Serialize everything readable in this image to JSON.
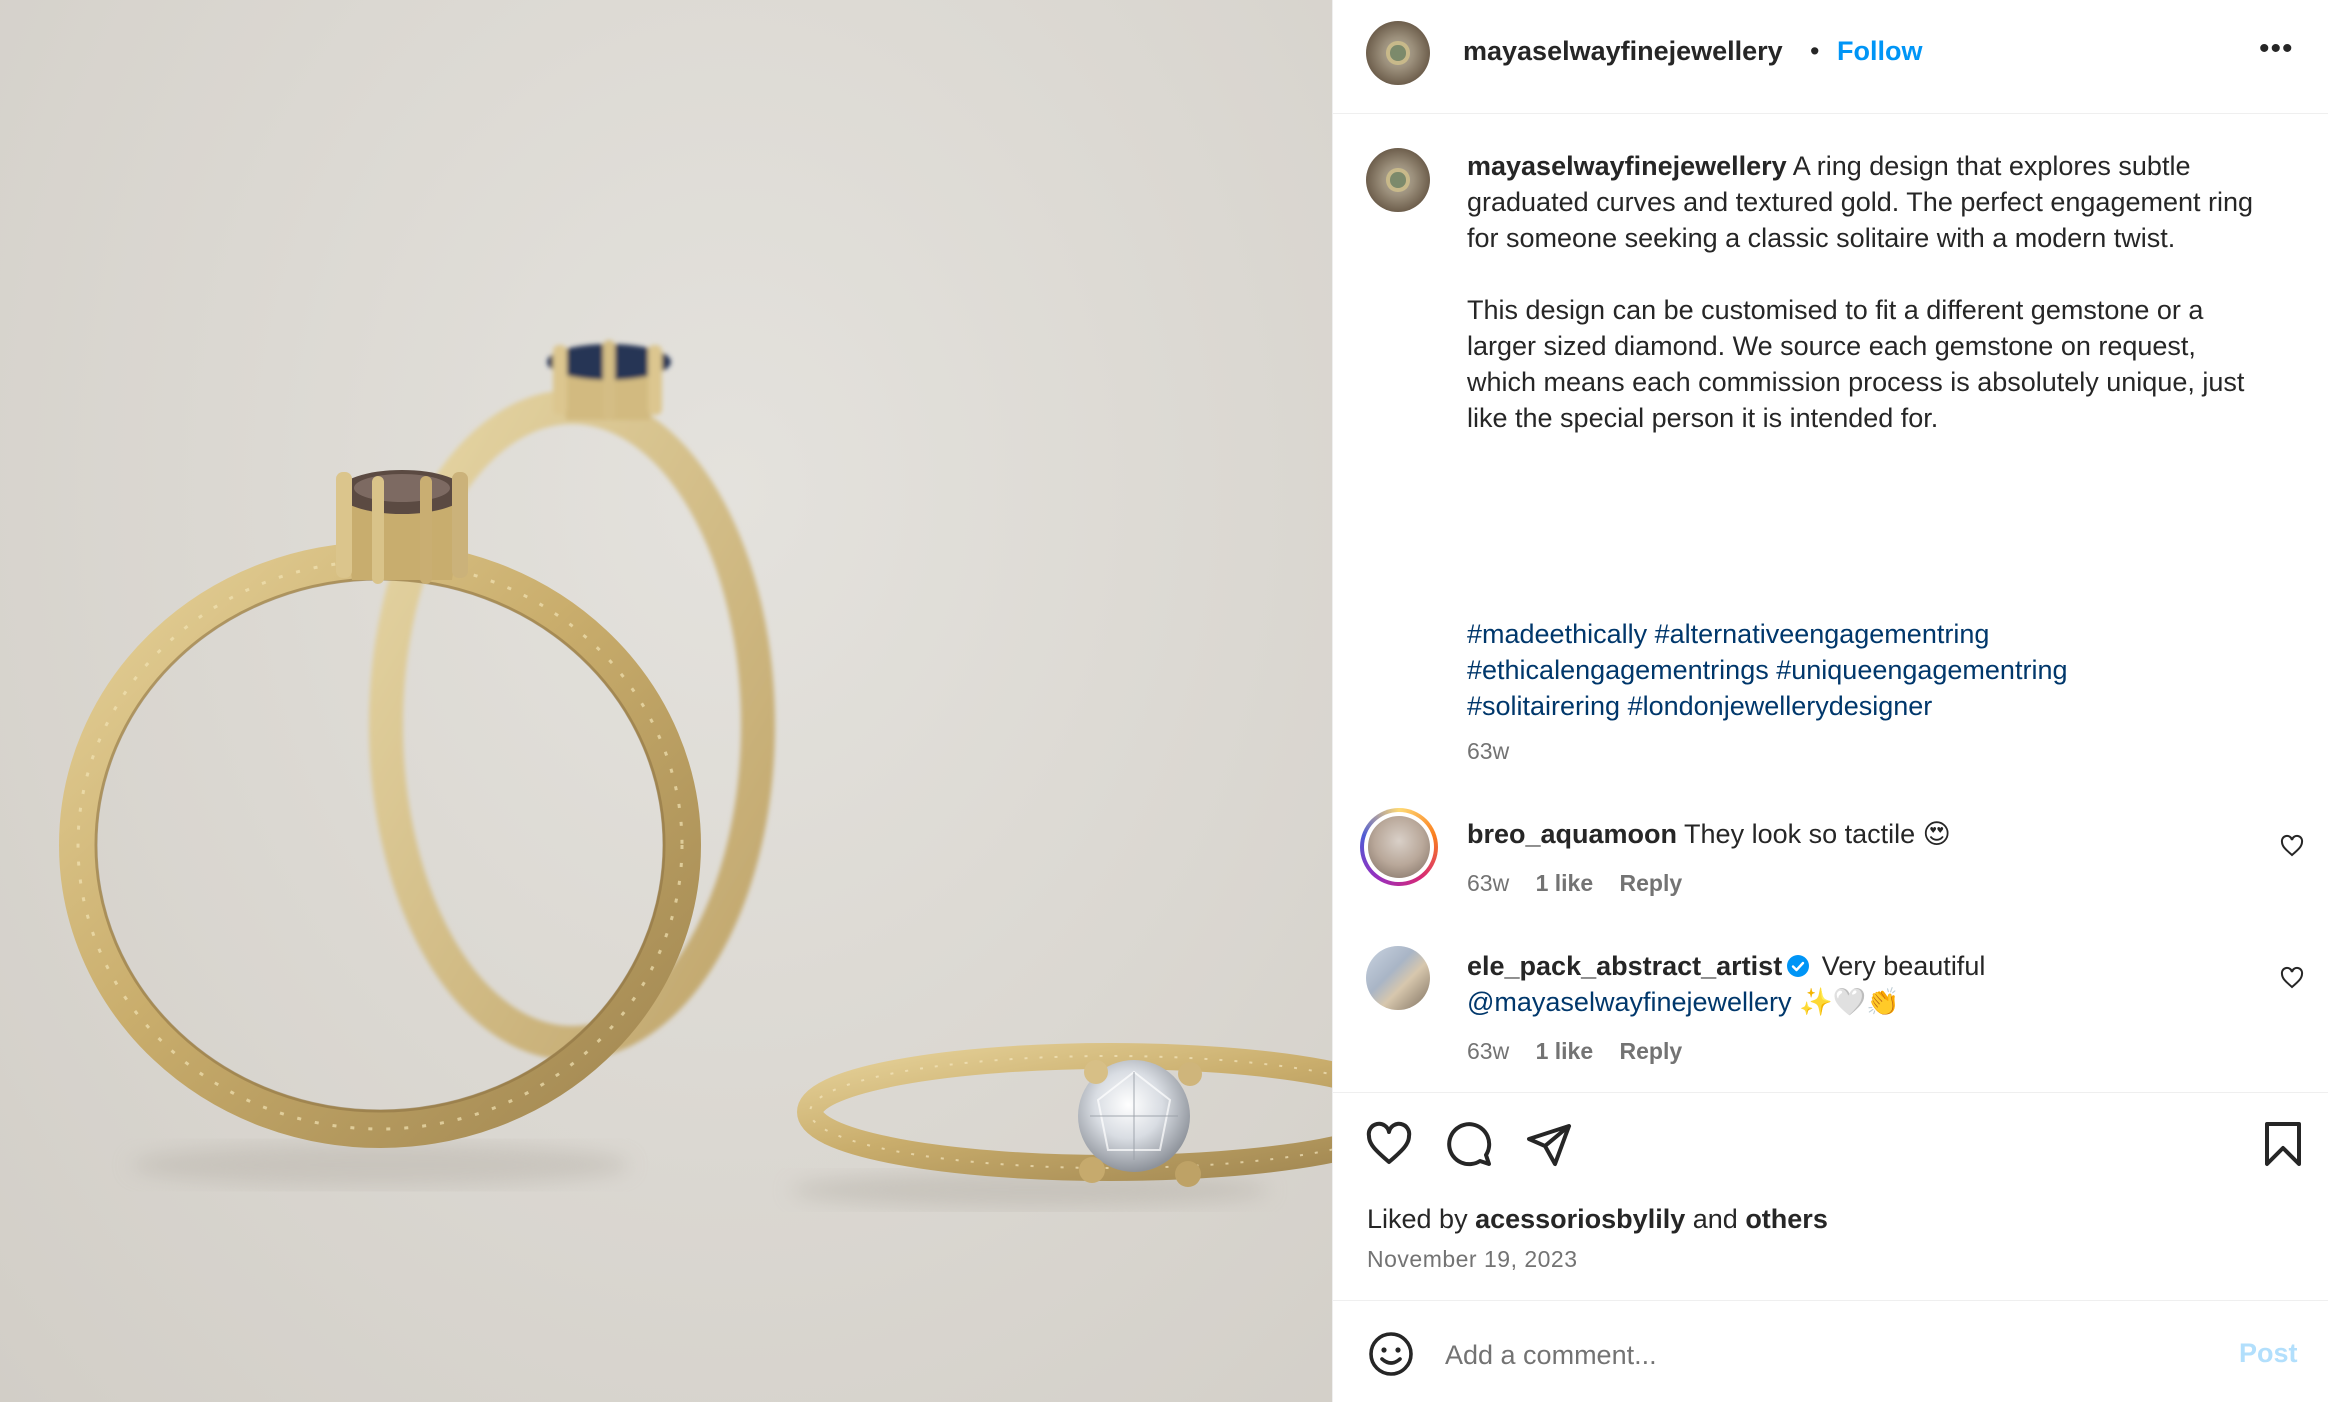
{
  "photo": {
    "alt": ""
  },
  "header": {
    "username": "mayaselwayfinejewellery",
    "separator": "•",
    "follow_label": "Follow",
    "more_icon": "more-horizontal-icon"
  },
  "caption": {
    "username": "mayaselwayfinejewellery",
    "text": " A ring design that explores subtle graduated curves and textured gold. The perfect engagement ring for someone seeking a classic solitaire with a modern twist.\n\nThis design can be customised to fit a different gemstone or a larger sized diamond. We source each gemstone on request, which means each commission process is absolutely unique, just like the special person it is intended for.",
    "hashtags": [
      "#madeethically",
      "#alternativeengagementring",
      "#ethicalengagementrings",
      "#uniqueengagementring",
      "#solitairering",
      "#londonjewellerydesigner"
    ],
    "time": "63w"
  },
  "comments": [
    {
      "username": "breo_aquamoon",
      "text": "They look so tactile 😍",
      "time": "63w",
      "likes": "1 like",
      "reply": "Reply"
    },
    {
      "username": "ele_pack_abstract_artist",
      "verified": true,
      "text": "Very beautiful",
      "mention": "@mayaselwayfinejewellery",
      "emoji": "✨🤍👏",
      "time": "63w",
      "likes": "1 like",
      "reply": "Reply"
    }
  ],
  "actions": {
    "like_icon": "heart-icon",
    "comment_icon": "comment-icon",
    "share_icon": "send-icon",
    "save_icon": "bookmark-icon"
  },
  "likes": {
    "prefix": "Liked by",
    "user": "acessoriosbylily",
    "and": "and",
    "others": "others"
  },
  "date": "November 19, 2023",
  "add_comment": {
    "placeholder": "Add a comment...",
    "post_label": "Post"
  },
  "colors": {
    "follow": "#0095f6",
    "hashtag": "#00376b",
    "muted": "#737373",
    "post_disabled": "#b2dffc"
  }
}
